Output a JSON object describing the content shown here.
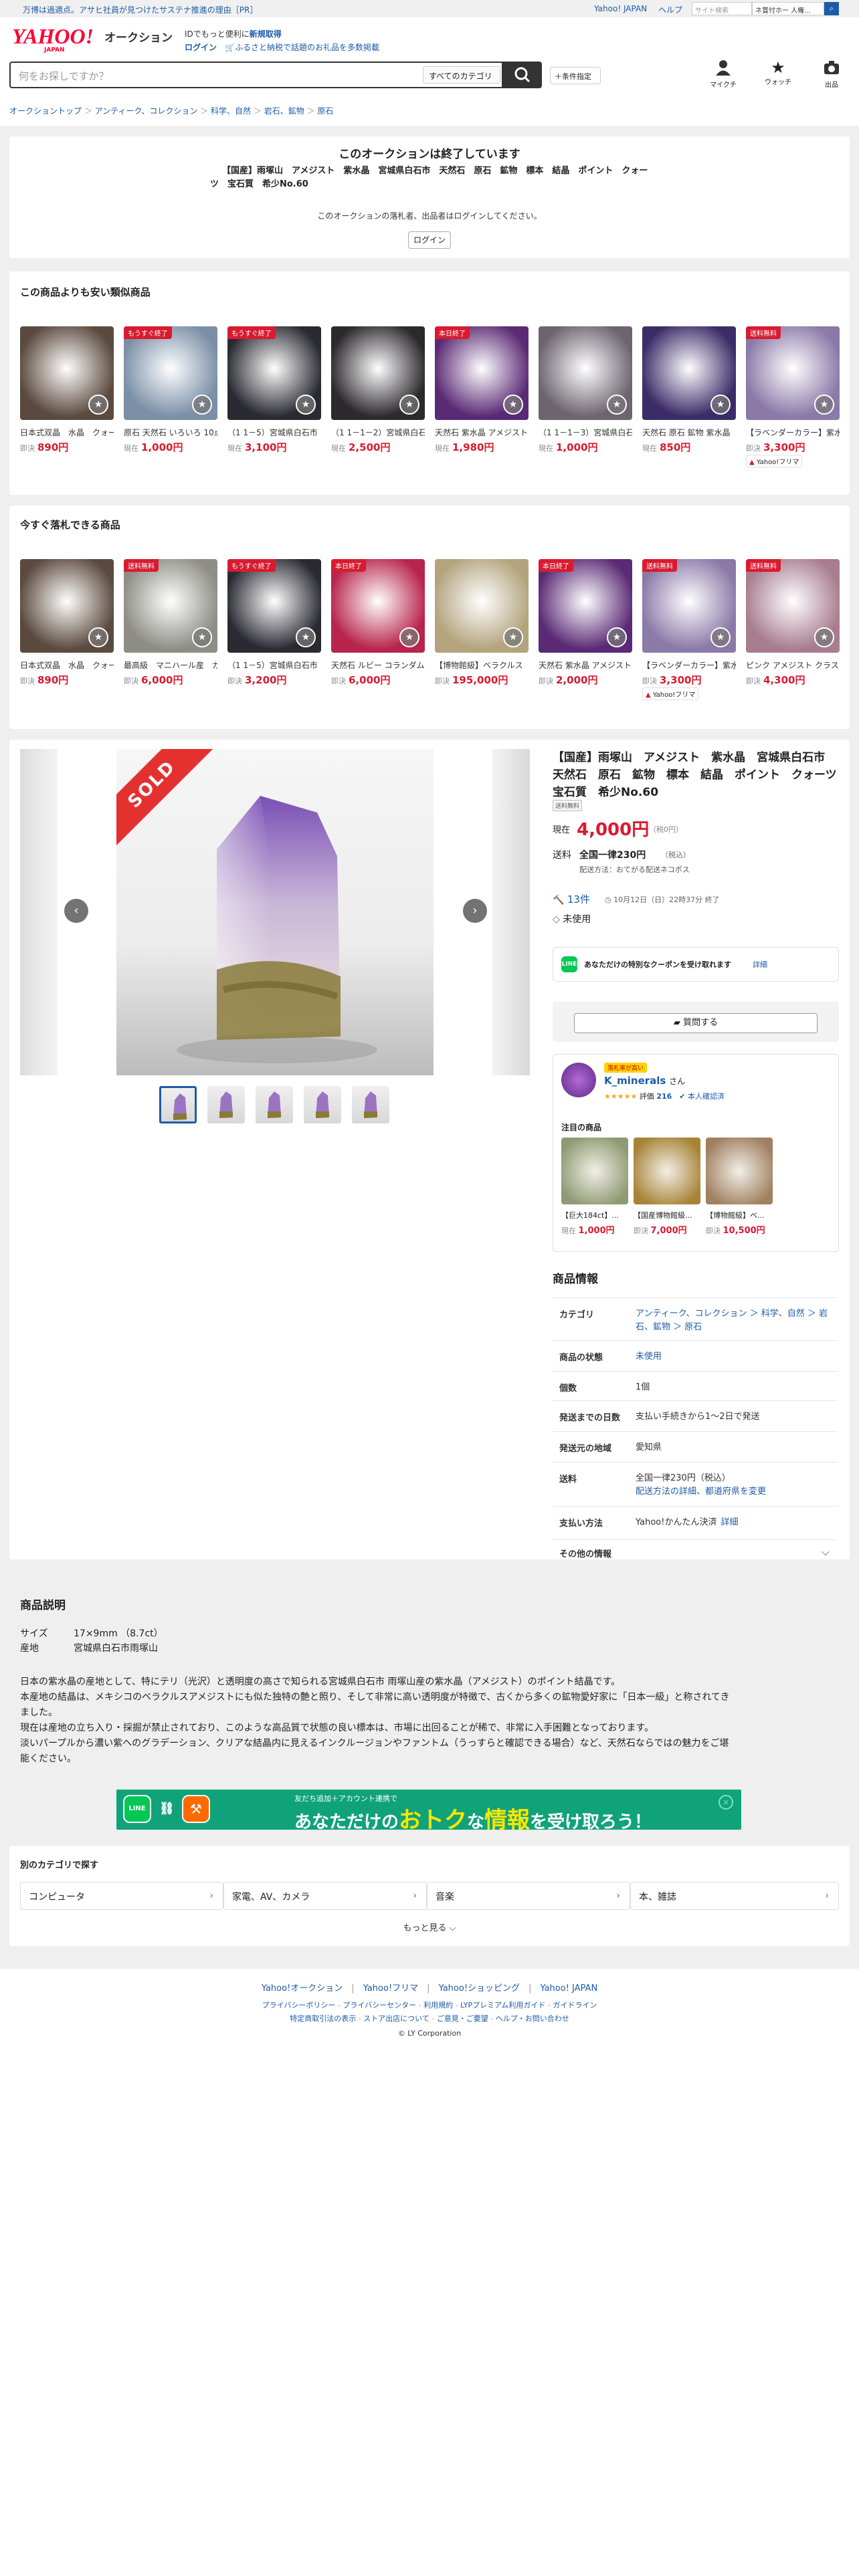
{
  "topbar": {
    "promo": "万博は過適点。アサヒ社員が見つけたサステナ推進の理由［PR］",
    "links": [
      "Yahoo! JAPAN",
      "ヘルプ"
    ],
    "mini_search_placeholder": "サイト検索",
    "mini_search_value": "ネ賞付ホー 人権..."
  },
  "header": {
    "logo": "YAHOO!",
    "logo_sub": "JAPAN",
    "service": "オークション",
    "id_prompt": "IDでもっと便利に",
    "register": "新規取得",
    "login": "ログイン",
    "furusato": "ふるさと納税で話題のお礼品を多数掲載",
    "search_placeholder": "何をお探しですか？",
    "category_select": "すべてのカテゴリ",
    "condition_button": "＋条件指定",
    "icons": [
      {
        "name": "mypage-icon",
        "label": "マイクチ"
      },
      {
        "name": "watch-star-icon",
        "label": "ウォッチ"
      },
      {
        "name": "camera-icon",
        "label": "出品"
      }
    ]
  },
  "breadcrumb": [
    "オークショントップ",
    "アンティーク、コレクション",
    "科学、自然",
    "岩石、鉱物",
    "原石"
  ],
  "ended": {
    "title": "このオークションは終了しています",
    "item_title": "【国産】雨塚山　アメジスト　紫水晶　宮城県白石市　天然石　原石　鉱物　標本　結晶　ポイント　クォーツ　宝石質　希少No.60",
    "note": "このオークションの落札者、出品者はログインしてください。",
    "login_button": "ログイン"
  },
  "similar": {
    "heading": "この商品よりも安い類似商品",
    "items": [
      {
        "title": "日本式双晶　水晶　クォーツ",
        "price_label": "即決",
        "price": "890円",
        "tag": "",
        "color": "#5b4a3f"
      },
      {
        "title": "原石 天然石 いろいろ 10点",
        "price_label": "現在",
        "price": "1,000円",
        "tag": "もうすぐ終了",
        "color": "#7b8fa6"
      },
      {
        "title": "（1 1－5）宮城県白石市",
        "price_label": "現在",
        "price": "3,100円",
        "tag": "もうすぐ終了",
        "color": "#2a2a33"
      },
      {
        "title": "（1 1－1－2）宮城県白石",
        "price_label": "現在",
        "price": "2,500円",
        "tag": "",
        "color": "#2d2a2e"
      },
      {
        "title": "天然石 紫水晶 アメジスト",
        "price_label": "現在",
        "price": "1,980円",
        "tag": "本日終了",
        "color": "#5a2a75"
      },
      {
        "title": "（1 1－1－3）宮城県白石",
        "price_label": "現在",
        "price": "1,000円",
        "tag": "",
        "color": "#6d6470"
      },
      {
        "title": "天然石 原石 鉱物 紫水晶",
        "price_label": "現在",
        "price": "850円",
        "tag": "",
        "color": "#3b2c68"
      },
      {
        "title": "【ラベンダーカラー】紫水晶",
        "price_label": "即決",
        "price": "3,300円",
        "tag": "送料無料",
        "color": "#8b79a8",
        "flea": "Yahoo!フリマ"
      }
    ]
  },
  "soon": {
    "heading": "今すぐ落札できる商品",
    "items": [
      {
        "title": "日本式双晶　水晶　クォーツ",
        "price_label": "即決",
        "price": "890円",
        "tag": "",
        "color": "#5b4a3f"
      },
      {
        "title": "最高級　マニハール産　ガーデン",
        "price_label": "即決",
        "price": "6,000円",
        "tag": "送料無料",
        "color": "#8e8e86"
      },
      {
        "title": "（1 1－5）宮城県白石市",
        "price_label": "即決",
        "price": "3,200円",
        "tag": "もうすぐ終了",
        "color": "#2a2a33"
      },
      {
        "title": "天然石 ルビー コランダム",
        "price_label": "即決",
        "price": "6,000円",
        "tag": "本日終了",
        "color": "#b8244d"
      },
      {
        "title": "【博物館級】ベラクルス",
        "price_label": "即決",
        "price": "195,000円",
        "tag": "",
        "color": "#b3a47e"
      },
      {
        "title": "天然石 紫水晶 アメジスト",
        "price_label": "即決",
        "price": "2,000円",
        "tag": "本日終了",
        "color": "#5a2a75"
      },
      {
        "title": "【ラベンダーカラー】紫水晶",
        "price_label": "即決",
        "price": "3,300円",
        "tag": "送料無料",
        "color": "#8b79a8",
        "flea": "Yahoo!フリマ"
      },
      {
        "title": "ピンク アメジスト クラスター",
        "price_label": "即決",
        "price": "4,300円",
        "tag": "送料無料",
        "color": "#a87d8f"
      }
    ]
  },
  "product": {
    "sold": "SOLD",
    "title": "【国産】雨塚山　アメジスト　紫水晶　宮城県白石市　天然石　原石　鉱物　標本　結晶　ポイント　クォーツ　宝石質　希少No.60",
    "badge": "送料無料",
    "current_label": "現在",
    "price": "4,000円",
    "tax": "（税0円）",
    "shipping_label": "送料",
    "shipping_value": "全国一律230円",
    "shipping_tax": "（税込）",
    "shipping_method": "配送方法：おてがる配送ネコポス",
    "bids": "13件",
    "end_time": "10月12日（日）22時37分 終了",
    "unused": "未使用",
    "coupon_text": "あなただけの特別なクーポンを受け取れます",
    "coupon_link": "詳細",
    "question_button": "質問する"
  },
  "seller": {
    "badge": "落札率が高い",
    "name": "K_minerals",
    "suffix": "さん",
    "rating_label": "評価",
    "rating": "216",
    "verified": "本人確認済",
    "featured_heading": "注目の商品",
    "featured": [
      {
        "title": "【巨大184ct】...",
        "price_label": "現在",
        "price": "1,000円",
        "color": "#8d9a73"
      },
      {
        "title": "【国産博物館級...",
        "price_label": "即決",
        "price": "7,000円",
        "color": "#a78336"
      },
      {
        "title": "【博物館級】ベ...",
        "price_label": "即決",
        "price": "10,500円",
        "color": "#a08060"
      }
    ]
  },
  "info": {
    "heading": "商品情報",
    "rows": [
      {
        "key": "カテゴリ",
        "value": "アンティーク、コレクション ＞ 科学、自然 ＞ 岩石、鉱物 ＞ 原石"
      },
      {
        "key": "商品の状態",
        "value": "未使用"
      },
      {
        "key": "個数",
        "value": "1個"
      },
      {
        "key": "発送までの日数",
        "value": "支払い手続きから1〜2日で発送"
      },
      {
        "key": "発送元の地域",
        "value": "愛知県"
      },
      {
        "key": "送料",
        "value": "全国一律230円（税込）",
        "sub": "配送方法の詳細、都道府県を変更"
      },
      {
        "key": "支払い方法",
        "value": "Yahoo!かんたん決済",
        "link": "詳細"
      }
    ],
    "other": "その他の情報"
  },
  "description": {
    "heading": "商品説明",
    "spec": [
      {
        "k": "サイズ",
        "v": "17×9mm （8.7ct）"
      },
      {
        "k": "産地",
        "v": "宮城県白石市雨塚山"
      }
    ],
    "lines": [
      "日本の紫水晶の産地として、特にテリ（光沢）と透明度の高さで知られる宮城県白石市 雨塚山産の紫水晶（アメジスト）のポイント結晶です。",
      "本産地の結晶は、メキシコのベラクルスアメジストにも似た独特の艶と照り、そして非常に高い透明度が特徴で、古くから多くの鉱物愛好家に「日本一級」と称されてき",
      "ました。",
      "現在は産地の立ち入り・採掘が禁止されており、このような高品質で状態の良い標本は、市場に出回ることが稀で、非常に入手困難となっております。",
      "淡いパープルから濃い紫へのグラデーション、クリアな結晶内に見えるインクルージョンやファントム（うっすらと確認できる場合）など、天然石ならではの魅力をご堪",
      "能ください。"
    ]
  },
  "banner": {
    "small": "友だち追加＋アカウント連携で",
    "big_pre": "あなただけの",
    "big_accent": "おトク",
    "big_mid": "な",
    "big_accent2": "情報",
    "big_post": "を受け取ろう！"
  },
  "categories": {
    "heading": "別のカテゴリで探す",
    "items": [
      "コンピュータ",
      "家電、AV、カメラ",
      "音楽",
      "本、雑誌"
    ],
    "more": "もっと見る"
  },
  "footer": {
    "main": [
      "Yahoo!オークション",
      "Yahoo!フリマ",
      "Yahoo!ショッピング",
      "Yahoo! JAPAN"
    ],
    "row2": [
      "プライバシーポリシー",
      "プライバシーセンター",
      "利用規約",
      "LYPプレミアム利用ガイド",
      "ガイドライン"
    ],
    "row3": [
      "特定商取引法の表示",
      "ストア出店について",
      "ご意見・ご要望",
      "ヘルプ・お問い合わせ"
    ],
    "copy": "© LY Corporation"
  },
  "colors": {
    "brand_red": "#ff0033",
    "price_red": "#d81b30",
    "link": "#1d5ba8",
    "line_green": "#06c755"
  }
}
